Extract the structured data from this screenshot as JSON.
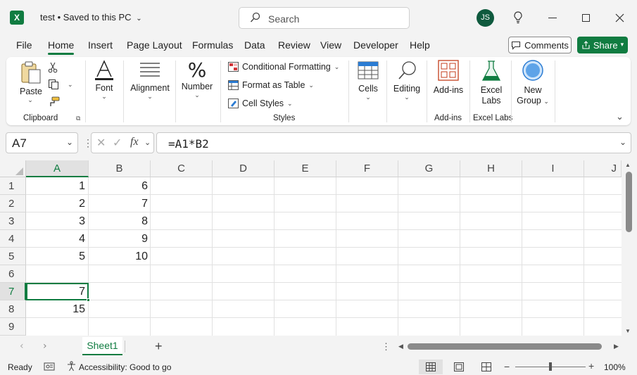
{
  "titlebar": {
    "app_icon": "X",
    "doc_title": "test • Saved to this PC",
    "search_placeholder": "Search",
    "avatar_initials": "JS"
  },
  "menu": {
    "tabs": [
      "File",
      "Home",
      "Insert",
      "Page Layout",
      "Formulas",
      "Data",
      "Review",
      "View",
      "Developer",
      "Help"
    ],
    "active_tab": "Home",
    "comments_label": "Comments",
    "share_label": "Share"
  },
  "ribbon": {
    "clipboard": {
      "paste": "Paste",
      "group": "Clipboard"
    },
    "font": {
      "label": "Font"
    },
    "alignment": {
      "label": "Alignment"
    },
    "number": {
      "label": "Number"
    },
    "styles": {
      "conditional_formatting": "Conditional Formatting",
      "format_as_table": "Format as Table",
      "cell_styles": "Cell Styles",
      "group": "Styles"
    },
    "cells": {
      "label": "Cells"
    },
    "editing": {
      "label": "Editing"
    },
    "addins": {
      "label": "Add-ins",
      "group": "Add-ins"
    },
    "excel_labs": {
      "label_line1": "Excel",
      "label_line2": "Labs",
      "group": "Excel Labs"
    },
    "new_group": {
      "label_line1": "New",
      "label_line2": "Group"
    }
  },
  "formula_bar": {
    "name_box": "A7",
    "fx": "fx",
    "formula": "=A1*B2"
  },
  "grid": {
    "columns": [
      "A",
      "B",
      "C",
      "D",
      "E",
      "F",
      "G",
      "H",
      "I",
      "J"
    ],
    "rows": [
      "1",
      "2",
      "3",
      "4",
      "5",
      "6",
      "7",
      "8",
      "9"
    ],
    "col_a": [
      "1",
      "2",
      "3",
      "4",
      "5",
      "",
      "7",
      "15",
      ""
    ],
    "col_b": [
      "6",
      "7",
      "8",
      "9",
      "10",
      "",
      "",
      "",
      ""
    ],
    "selected_cell": "A7"
  },
  "sheets": {
    "active": "Sheet1",
    "add": "+"
  },
  "status": {
    "ready": "Ready",
    "accessibility": "Accessibility: Good to go",
    "zoom": "100%",
    "zoom_minus": "−",
    "zoom_plus": "+"
  },
  "colors": {
    "accent": "#107c41",
    "selection": "#107c41"
  }
}
